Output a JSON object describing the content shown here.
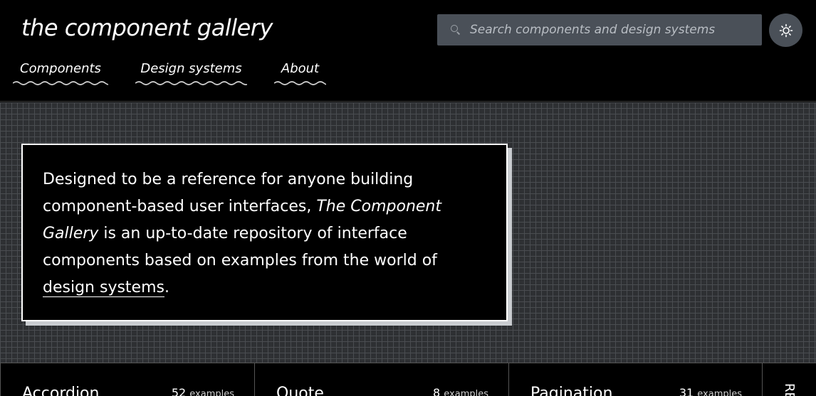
{
  "header": {
    "logo": "the component gallery",
    "search_placeholder": "Search components and design systems",
    "theme_icon": "sun-icon"
  },
  "nav": {
    "items": [
      {
        "label": "Components"
      },
      {
        "label": "Design systems"
      },
      {
        "label": "About"
      }
    ]
  },
  "intro": {
    "text_before": "Designed to be a reference for anyone building component-based user interfaces, ",
    "title_italic": "The Component Gallery",
    "text_middle": " is an up-to-date repository of interface components based on examples from the world of ",
    "link": "design systems",
    "text_after": "."
  },
  "cards": [
    {
      "title": "Accordion",
      "count": "52",
      "unit": "examples"
    },
    {
      "title": "Quote",
      "count": "8",
      "unit": "examples"
    },
    {
      "title": "Pagination",
      "count": "31",
      "unit": "examples"
    },
    {
      "title": "RE"
    }
  ]
}
